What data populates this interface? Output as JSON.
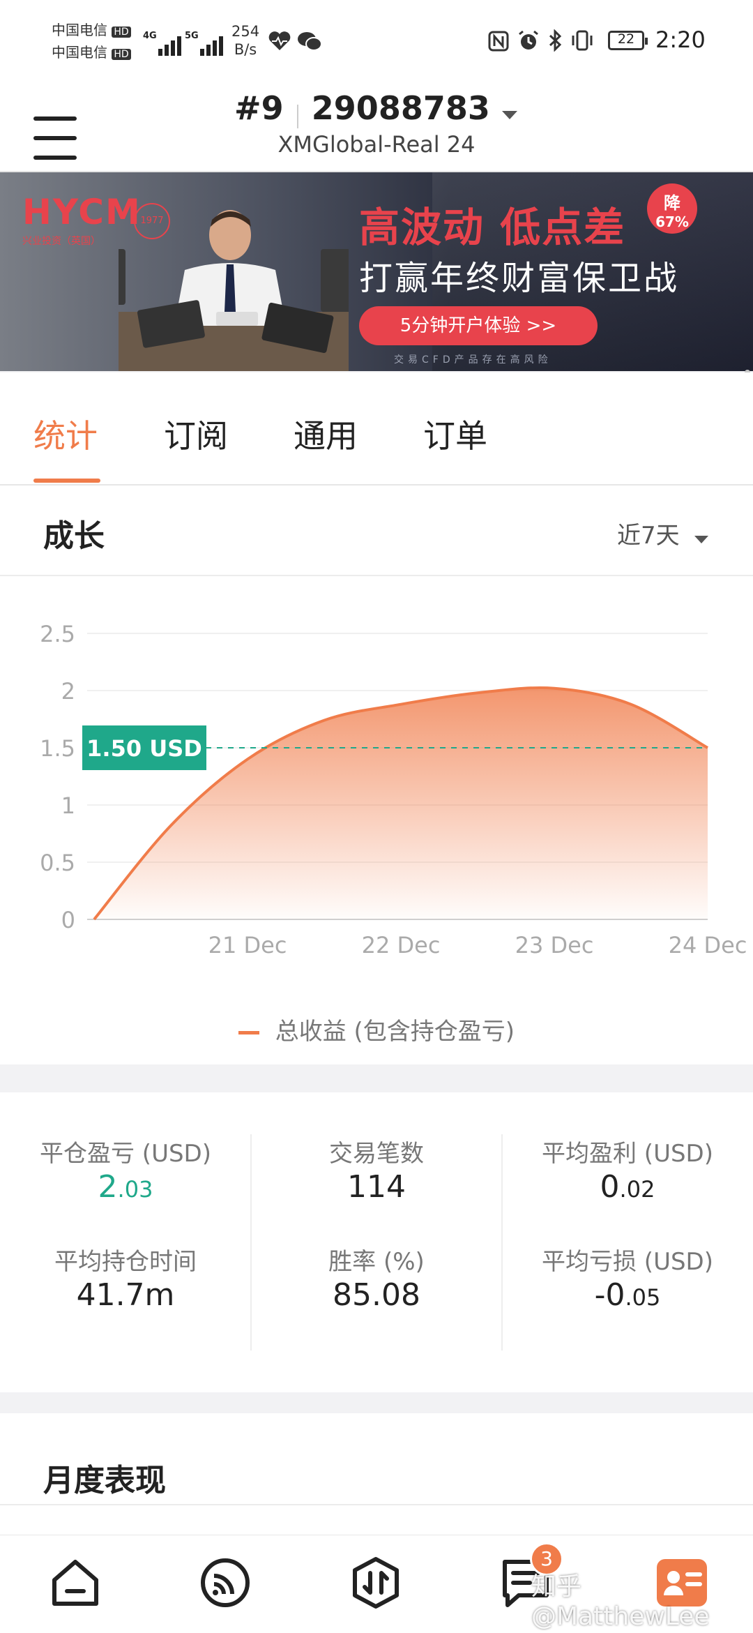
{
  "status_bar": {
    "carrier1": "中国电信",
    "carrier2": "中国电信",
    "hd_badge": "HD",
    "net1": "4G",
    "net2": "5G",
    "speed_value": "254",
    "speed_unit": "B/s",
    "battery": "22",
    "time": "2:20"
  },
  "header": {
    "rank": "#9",
    "account_number": "29088783",
    "server": "XMGlobal-Real 24"
  },
  "banner": {
    "logo": "HYCM",
    "logo_sub": "兴业投资（英国）",
    "logo_since": "1977",
    "headline": "高波动 低点差",
    "subline": "打赢年终财富保卫战",
    "badge_top": "降",
    "badge_bottom": "67%",
    "cta": "5分钟开户体验 >>",
    "disclaimer": "交易CFD产品存在高风险"
  },
  "tabs": [
    {
      "label": "统计",
      "active": true
    },
    {
      "label": "订阅",
      "active": false
    },
    {
      "label": "通用",
      "active": false
    },
    {
      "label": "订单",
      "active": false
    }
  ],
  "growth": {
    "title": "成长",
    "period": "近7天"
  },
  "chart_data": {
    "type": "area",
    "x": [
      "20 Dec",
      "20.5 Dec",
      "21 Dec",
      "21.5 Dec",
      "22 Dec",
      "22.5 Dec",
      "23 Dec",
      "23.5 Dec",
      "24 Dec"
    ],
    "x_tick_labels": [
      "21 Dec",
      "22 Dec",
      "23 Dec",
      "24 Dec"
    ],
    "series": [
      {
        "name": "总收益 (包含持仓盈亏)",
        "values": [
          0,
          0.82,
          1.4,
          1.74,
          1.88,
          1.98,
          2.02,
          1.88,
          1.5
        ],
        "color": "#f07c4a"
      }
    ],
    "y_ticks": [
      "0",
      "0.5",
      "1",
      "1.5",
      "2",
      "2.5"
    ],
    "ylim": [
      0,
      2.5
    ],
    "current_value": 1.5,
    "current_label": "1.50 USD",
    "grid": true,
    "legend": "bottom-center"
  },
  "stats": {
    "items": [
      {
        "label": "平仓盈亏 (USD)",
        "int": "2",
        "dec": ".03",
        "highlight": true
      },
      {
        "label": "交易笔数",
        "int": "114",
        "dec": "",
        "highlight": false
      },
      {
        "label": "平均盈利 (USD)",
        "int": "0",
        "dec": ".02",
        "highlight": false
      },
      {
        "label": "平均持仓时间",
        "int": "41.7m",
        "dec": "",
        "highlight": false
      },
      {
        "label": "胜率 (%)",
        "int": "85.08",
        "dec": "",
        "highlight": false
      },
      {
        "label": "平均亏损 (USD)",
        "int": "-0",
        "dec": ".05",
        "highlight": false
      }
    ]
  },
  "monthly": {
    "title": "月度表现"
  },
  "bottom_nav": {
    "messages_badge": "3",
    "watermark": "知乎 @MatthewLee"
  },
  "colors": {
    "accent": "#f07c4a",
    "green": "#1fa88a",
    "banner_red": "#e8434c"
  }
}
